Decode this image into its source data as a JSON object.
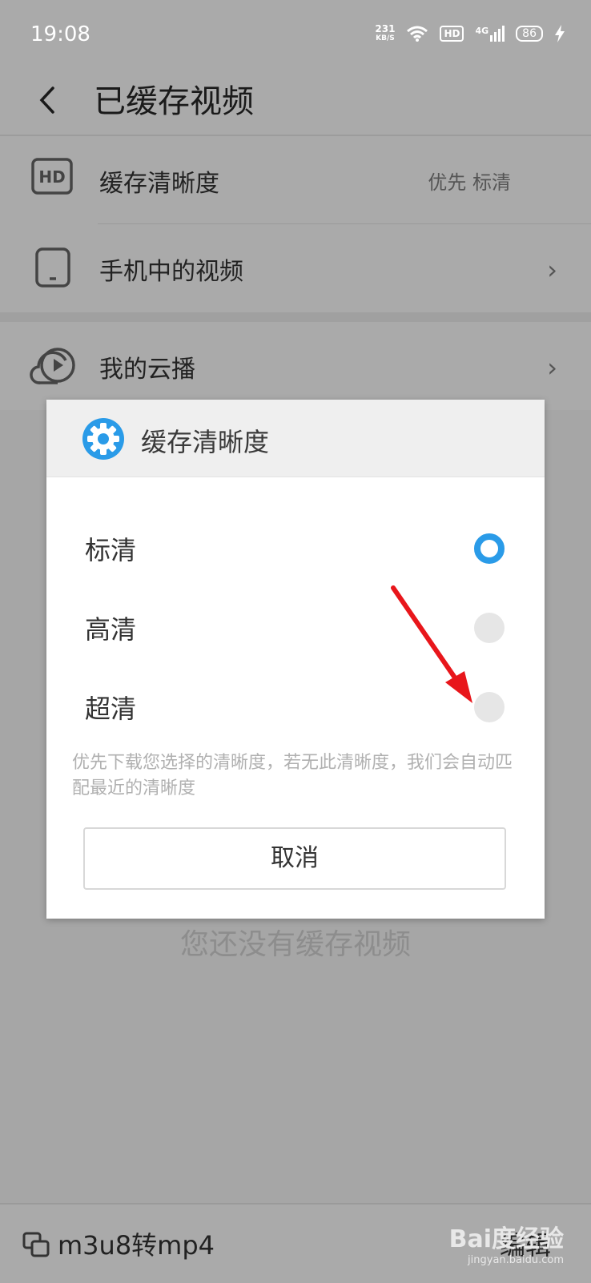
{
  "status_bar": {
    "time": "19:08",
    "net_speed_value": "231",
    "net_speed_unit": "KB/S",
    "hd_badge": "HD",
    "network": "4G",
    "battery": "86"
  },
  "app_bar": {
    "title": "已缓存视频"
  },
  "list": {
    "items": [
      {
        "label": "缓存清晰度",
        "value": "优先 标清",
        "icon": "hd-icon"
      },
      {
        "label": "手机中的视频",
        "chevron": "›",
        "icon": "phone-icon"
      },
      {
        "label": "我的云播",
        "chevron": "›",
        "icon": "cloud-play-icon"
      }
    ]
  },
  "empty_text": "您还没有缓存视频",
  "bottom_bar": {
    "convert_label": "m3u8转mp4",
    "edit_label": "编辑"
  },
  "watermark": {
    "brand": "Bai度经验",
    "url": "jingyan.baidu.com"
  },
  "dialog": {
    "title": "缓存清晰度",
    "options": [
      {
        "label": "标清",
        "selected": true
      },
      {
        "label": "高清",
        "selected": false
      },
      {
        "label": "超清",
        "selected": false
      }
    ],
    "hint": "优先下载您选择的清晰度，若无此清晰度，我们会自动匹配最近的清晰度",
    "cancel_label": "取消"
  },
  "colors": {
    "accent": "#2a9be8",
    "annotation_arrow": "#e8161b",
    "overlay": "#a6a6a6"
  }
}
